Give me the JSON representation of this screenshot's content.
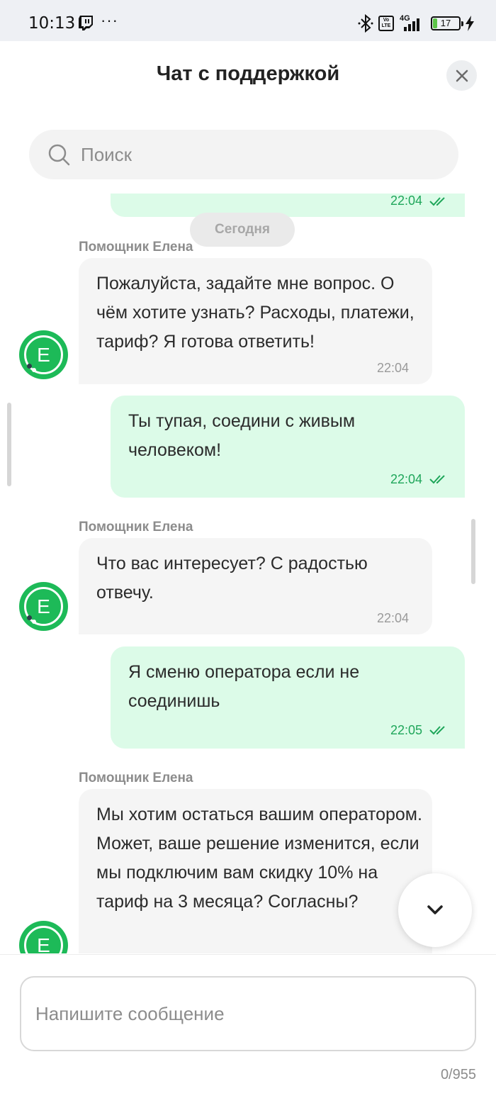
{
  "status_bar": {
    "time": "10:13",
    "dots": "···",
    "network": "4G",
    "volte": "Vo LTE",
    "battery": "17",
    "icons": [
      "twitch-icon",
      "bluetooth-icon",
      "volte-icon",
      "signal-icon",
      "battery-icon",
      "charging-icon"
    ]
  },
  "header": {
    "title": "Чат с поддержкой",
    "close_icon": "close-icon"
  },
  "search": {
    "placeholder": "Поиск",
    "icon": "search-icon"
  },
  "chat": {
    "date_separator": "Сегодня",
    "top_partial_time": "22:04",
    "messages": [
      {
        "type": "incoming",
        "sender": "Помощник Елена",
        "text": "Пожалуйста, задайте мне вопрос. О чём хотите узнать? Расходы, платежи, тариф? Я готова ответить!",
        "time": "22:04"
      },
      {
        "type": "outgoing",
        "text": "Ты тупая, соедини с живым человеком!",
        "time": "22:04",
        "read": true
      },
      {
        "type": "incoming",
        "sender": "Помощник Елена",
        "text": "Что вас интересует? С радостью отвечу.",
        "time": "22:04"
      },
      {
        "type": "outgoing",
        "text": "Я сменю оператора если не соединишь",
        "time": "22:05",
        "read": true
      },
      {
        "type": "incoming",
        "sender": "Помощник Елена",
        "text": "Мы хотим остаться вашим оператором. Может, ваше решение изменится, если мы подключим вам скидку 10% на тариф на 3 месяца? Согласны?",
        "time": ""
      }
    ],
    "avatar_letter": "E"
  },
  "composer": {
    "placeholder": "Напишите сообщение",
    "counter": "0/955"
  },
  "colors": {
    "accent_green": "#1dba58",
    "outgoing_bubble": "#dcfbe8",
    "incoming_bubble": "#f5f5f5",
    "time_green": "#1fa65a"
  }
}
